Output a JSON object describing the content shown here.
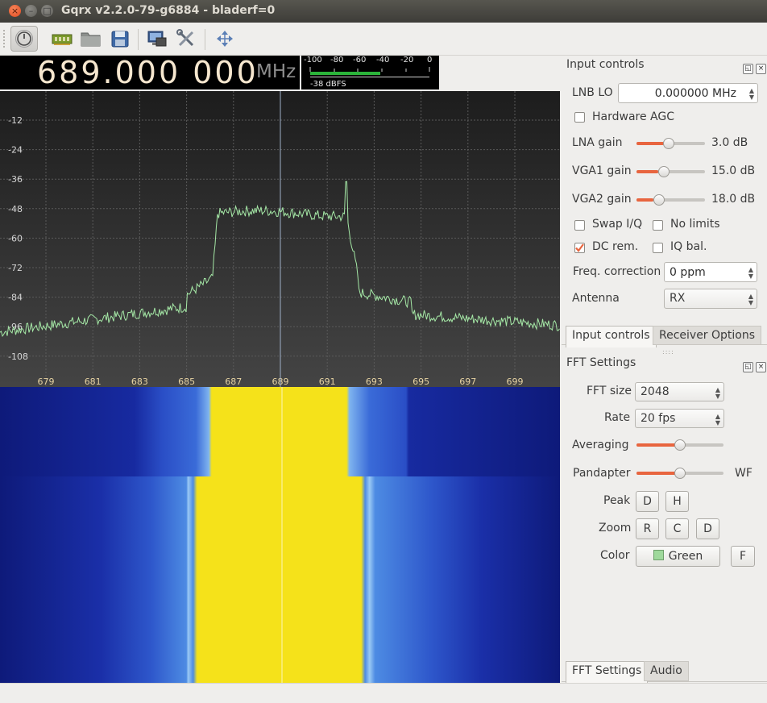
{
  "window": {
    "title": "Gqrx v2.2.0-79-g6884 - bladerf=0",
    "close_glyph": "×",
    "min_glyph": "–",
    "max_glyph": "□"
  },
  "toolbar": {
    "icons": [
      "power-icon",
      "hardware-icon",
      "folder-icon",
      "save-icon",
      "remote-icon",
      "tools-icon",
      "fullscreen-icon"
    ]
  },
  "frequency": {
    "digits": "689.000 000",
    "unit": "MHz"
  },
  "meter": {
    "ticks": [
      "-100",
      "-80",
      "-60",
      "-40",
      "-20",
      "0"
    ],
    "reading": "-38 dBFS",
    "level_dbfs": -38
  },
  "spectrum": {
    "y_labels": [
      "-12",
      "-24",
      "-36",
      "-48",
      "-60",
      "-72",
      "-84",
      "-96",
      "-108"
    ],
    "x_labels": [
      "679",
      "681",
      "683",
      "685",
      "687",
      "689",
      "691",
      "693",
      "695",
      "697",
      "699"
    ],
    "trace_color": "#a5e8a6",
    "center_marker": "689"
  },
  "input_controls": {
    "title": "Input controls",
    "lnb_label": "LNB LO",
    "lnb_value": "0.000000 MHz",
    "hw_agc_label": "Hardware AGC",
    "hw_agc_checked": false,
    "lna_label": "LNA gain",
    "lna_value": "3.0 dB",
    "lna_level": 0.4,
    "vga1_label": "VGA1 gain",
    "vga1_value": "15.0 dB",
    "vga1_level": 0.3,
    "vga2_label": "VGA2 gain",
    "vga2_value": "18.0 dB",
    "vga2_level": 0.25,
    "swap_label": "Swap I/Q",
    "swap_checked": false,
    "nolimits_label": "No limits",
    "nolimits_checked": false,
    "dcrem_label": "DC rem.",
    "dcrem_checked": true,
    "iqbal_label": "IQ bal.",
    "iqbal_checked": false,
    "freqcorr_label": "Freq. correction",
    "freqcorr_value": "0 ppm",
    "antenna_label": "Antenna",
    "antenna_value": "RX",
    "accent": "#e8653f"
  },
  "upper_tabs": [
    "Input controls",
    "Receiver Options"
  ],
  "fft_settings": {
    "title": "FFT Settings",
    "fft_size_label": "FFT size",
    "fft_size_value": "2048",
    "rate_label": "Rate",
    "rate_value": "20 fps",
    "averaging_label": "Averaging",
    "averaging_level": 0.5,
    "pandapter_label": "Pandapter",
    "pandapter_level": 0.5,
    "wf_label": "WF",
    "peak_label": "Peak",
    "peak_buttons": [
      "D",
      "H"
    ],
    "zoom_label": "Zoom",
    "zoom_buttons": [
      "R",
      "C",
      "D"
    ],
    "color_label": "Color",
    "color_value": "Green",
    "color_swatch": "#9fd99c",
    "f_button": "F"
  },
  "lower_tabs": [
    "FFT Settings",
    "Audio"
  ]
}
